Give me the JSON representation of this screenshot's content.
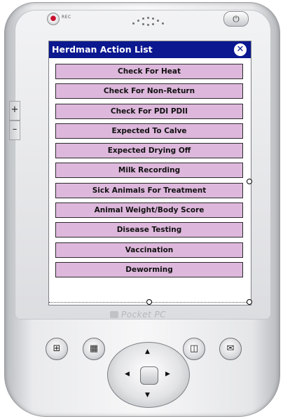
{
  "window": {
    "title": "Herdman Action List",
    "close_glyph": "✕"
  },
  "device": {
    "rec_label": "REC",
    "power_glyph": "⏻",
    "brand": "Pocket PC",
    "plus_key": "+",
    "minus_key": "–"
  },
  "actions": [
    "Check For Heat",
    "Check For Non-Return",
    "Check For PDI  PDII",
    "Expected To Calve",
    "Expected Drying Off",
    "Milk Recording",
    "Sick Animals For Treatment",
    "Animal Weight/Body Score",
    "Disease Testing",
    "Vaccination",
    "Deworming"
  ],
  "hardware_buttons": {
    "start_glyph": "⊞",
    "calendar_glyph": "▦",
    "contacts_glyph": "◫",
    "inbox_glyph": "✉"
  },
  "dpad": {
    "up": "▲",
    "down": "▼",
    "left": "◀",
    "right": "▶"
  },
  "colors": {
    "titlebar": "#0b1890",
    "button_fill": "#ddb8dc"
  },
  "icons": [
    "record-icon",
    "power-icon",
    "close-icon",
    "windows-start-icon",
    "calendar-icon",
    "contacts-icon",
    "inbox-icon"
  ]
}
